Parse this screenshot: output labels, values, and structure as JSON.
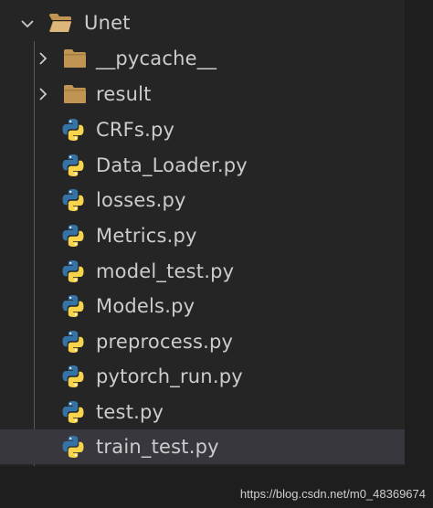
{
  "explorer": {
    "root_folder": {
      "label": "Unet",
      "expanded": true,
      "icon": "folder-open-icon"
    },
    "folders": [
      {
        "label": "__pycache__",
        "expanded": false,
        "icon": "folder-icon"
      },
      {
        "label": "result",
        "expanded": false,
        "icon": "folder-icon"
      }
    ],
    "files": [
      {
        "label": "CRFs.py",
        "icon": "python-file-icon"
      },
      {
        "label": "Data_Loader.py",
        "icon": "python-file-icon"
      },
      {
        "label": "losses.py",
        "icon": "python-file-icon"
      },
      {
        "label": "Metrics.py",
        "icon": "python-file-icon"
      },
      {
        "label": "model_test.py",
        "icon": "python-file-icon"
      },
      {
        "label": "Models.py",
        "icon": "python-file-icon"
      },
      {
        "label": "preprocess.py",
        "icon": "python-file-icon"
      },
      {
        "label": "pytorch_run.py",
        "icon": "python-file-icon"
      },
      {
        "label": "test.py",
        "icon": "python-file-icon"
      },
      {
        "label": "train_test.py",
        "icon": "python-file-icon",
        "selected": true
      }
    ]
  },
  "watermark": "https://blog.csdn.net/m0_48369674",
  "colors": {
    "background": "#1e1e1e",
    "panel": "#252526",
    "selected_row": "#37373d",
    "text": "#cccccc",
    "folder": "#c09553",
    "python_blue": "#3572a5",
    "python_yellow": "#f7d44c"
  }
}
